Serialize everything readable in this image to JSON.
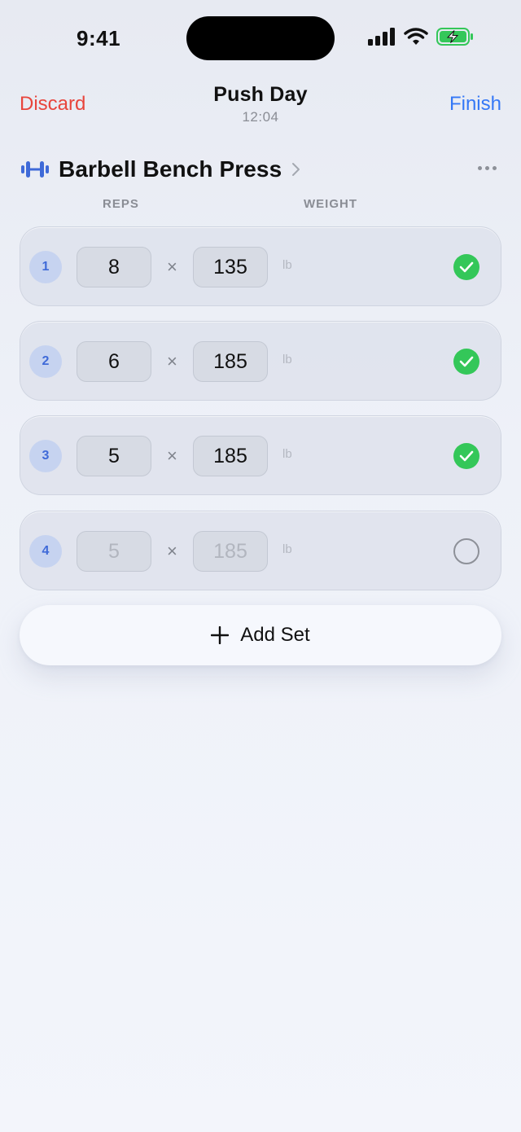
{
  "status_bar": {
    "time": "9:41",
    "icons": [
      "cellular-signal-icon",
      "wifi-icon",
      "battery-charging-icon"
    ]
  },
  "nav": {
    "discard_label": "Discard",
    "title": "Push Day",
    "elapsed": "12:04",
    "finish_label": "Finish"
  },
  "exercise": {
    "icon": "dumbbell-icon",
    "name": "Barbell Bench Press",
    "columns": {
      "reps": "REPS",
      "weight": "WEIGHT"
    },
    "sets": [
      {
        "number": "1",
        "reps": "8",
        "weight": "135",
        "unit": "lb",
        "completed": true
      },
      {
        "number": "2",
        "reps": "6",
        "weight": "185",
        "unit": "lb",
        "completed": true
      },
      {
        "number": "3",
        "reps": "5",
        "weight": "185",
        "unit": "lb",
        "completed": true
      },
      {
        "number": "4",
        "reps": "5",
        "weight": "185",
        "unit": "lb",
        "completed": false
      }
    ],
    "times_symbol": "×"
  },
  "add_set": {
    "label": "Add Set"
  },
  "colors": {
    "discard": "#e8453c",
    "finish": "#3478f6",
    "accent": "#3f6ad8",
    "check_done": "#34c759"
  }
}
